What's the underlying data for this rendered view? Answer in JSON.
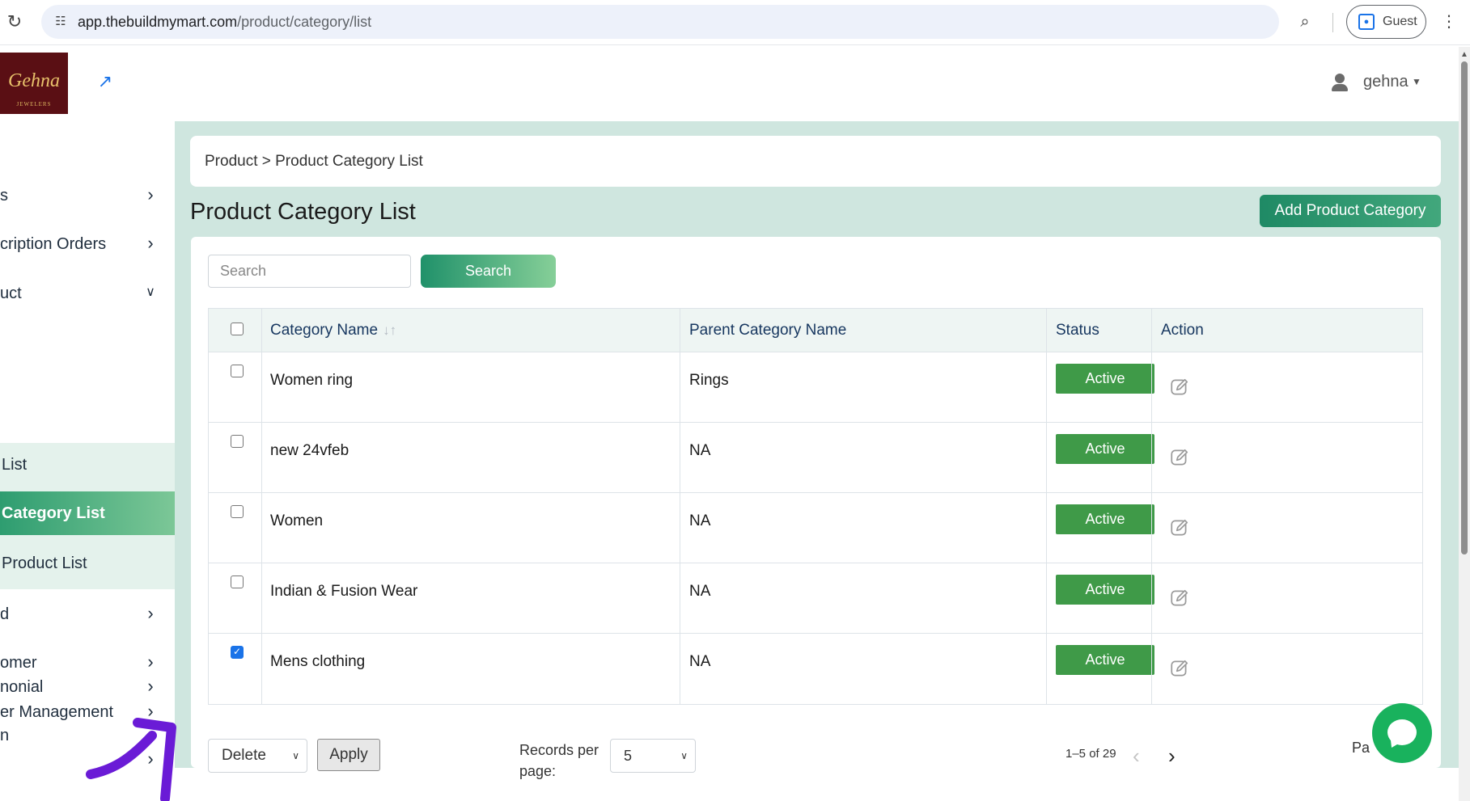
{
  "browser": {
    "url_host": "app.thebuildmymart.com",
    "url_path": "/product/category/list",
    "profile_label": "Guest"
  },
  "header": {
    "logo_text": "Gehna",
    "logo_subtext": "JEWELERS",
    "user_name": "gehna"
  },
  "sidebar": {
    "items": [
      {
        "label": "s",
        "top": 0
      },
      {
        "label": "cription Orders",
        "top": 0
      },
      {
        "label": "uct",
        "top": 0
      },
      {
        "label": "d",
        "top": 0
      },
      {
        "label": "omer",
        "top": 0
      },
      {
        "label": "er Management",
        "top": 0
      },
      {
        "label": "",
        "top": 0
      },
      {
        "label": "nonial",
        "top": 0
      },
      {
        "label": "n",
        "top": 0
      }
    ],
    "submenu": [
      {
        "label": "List"
      },
      {
        "label": "Category List"
      },
      {
        "label": "Product List"
      }
    ]
  },
  "breadcrumb": "Product > Product Category List",
  "page_title": "Product Category List",
  "add_button_label": "Add Product Category",
  "search": {
    "placeholder": "Search",
    "button_label": "Search"
  },
  "table": {
    "columns": [
      "Category Name",
      "Parent Category Name",
      "Status",
      "Action"
    ],
    "rows": [
      {
        "category": "Women ring",
        "parent": "Rings",
        "status": "Active",
        "checked": false
      },
      {
        "category": "new 24vfeb",
        "parent": "NA",
        "status": "Active",
        "checked": false
      },
      {
        "category": "Women",
        "parent": "NA",
        "status": "Active",
        "checked": false
      },
      {
        "category": "Indian & Fusion Wear",
        "parent": "NA",
        "status": "Active",
        "checked": false
      },
      {
        "category": "Mens clothing",
        "parent": "NA",
        "status": "Active",
        "checked": true
      }
    ]
  },
  "footer": {
    "bulk_action": "Delete",
    "apply_label": "Apply",
    "records_per_page_label": "Records per page:",
    "records_per_page_value": "5",
    "range_text": "1–5 of 29",
    "page_label": "Pa"
  },
  "colors": {
    "accent": "#2e9d70",
    "status_active": "#3f9a48",
    "main_bg": "#cfe6df",
    "annotation": "#6a1bd6"
  }
}
